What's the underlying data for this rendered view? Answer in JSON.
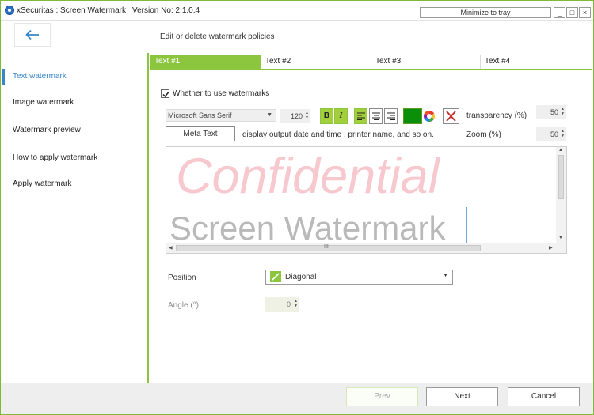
{
  "window": {
    "title": "xSecuritas : Screen Watermark",
    "version": "Version No: 2.1.0.4",
    "tray_button": "Minimize to tray",
    "min_symbol": "_",
    "max_symbol": "□",
    "close_symbol": "×"
  },
  "header": {
    "heading": "Edit or delete watermark policies"
  },
  "sidebar": {
    "items": [
      {
        "label": "Text watermark",
        "active": true
      },
      {
        "label": "Image watermark",
        "active": false
      },
      {
        "label": "Watermark preview",
        "active": false
      },
      {
        "label": "How to apply watermark",
        "active": false
      },
      {
        "label": "Apply watermark",
        "active": false
      }
    ]
  },
  "tabs": [
    {
      "label": "Text #1",
      "active": true
    },
    {
      "label": "Text #2",
      "active": false
    },
    {
      "label": "Text #3",
      "active": false
    },
    {
      "label": "Text #4",
      "active": false
    }
  ],
  "options": {
    "use_watermark_label": "Whether to use watermarks",
    "use_watermark_checked": true,
    "font_name": "Microsoft Sans Serif",
    "font_size": "120",
    "bold_label": "B",
    "italic_label": "I",
    "text_color": "#0b8f0b",
    "transparency_label": "transparency (%)",
    "transparency_value": "50",
    "meta_button": "Meta Text",
    "meta_description": "display output date and time , printer name, and so on.",
    "zoom_label": "Zoom (%)",
    "zoom_value": "50"
  },
  "preview": {
    "line1": "Confidential",
    "line2": "Screen Watermark",
    "hscroll_grip": "III"
  },
  "position": {
    "label": "Position",
    "value": "Diagonal",
    "angle_label": "Angle (°)",
    "angle_value": "0"
  },
  "footer": {
    "prev": "Prev",
    "next": "Next",
    "cancel": "Cancel"
  },
  "colors": {
    "accent": "#8cc63f",
    "active_link": "#3a86c8"
  }
}
